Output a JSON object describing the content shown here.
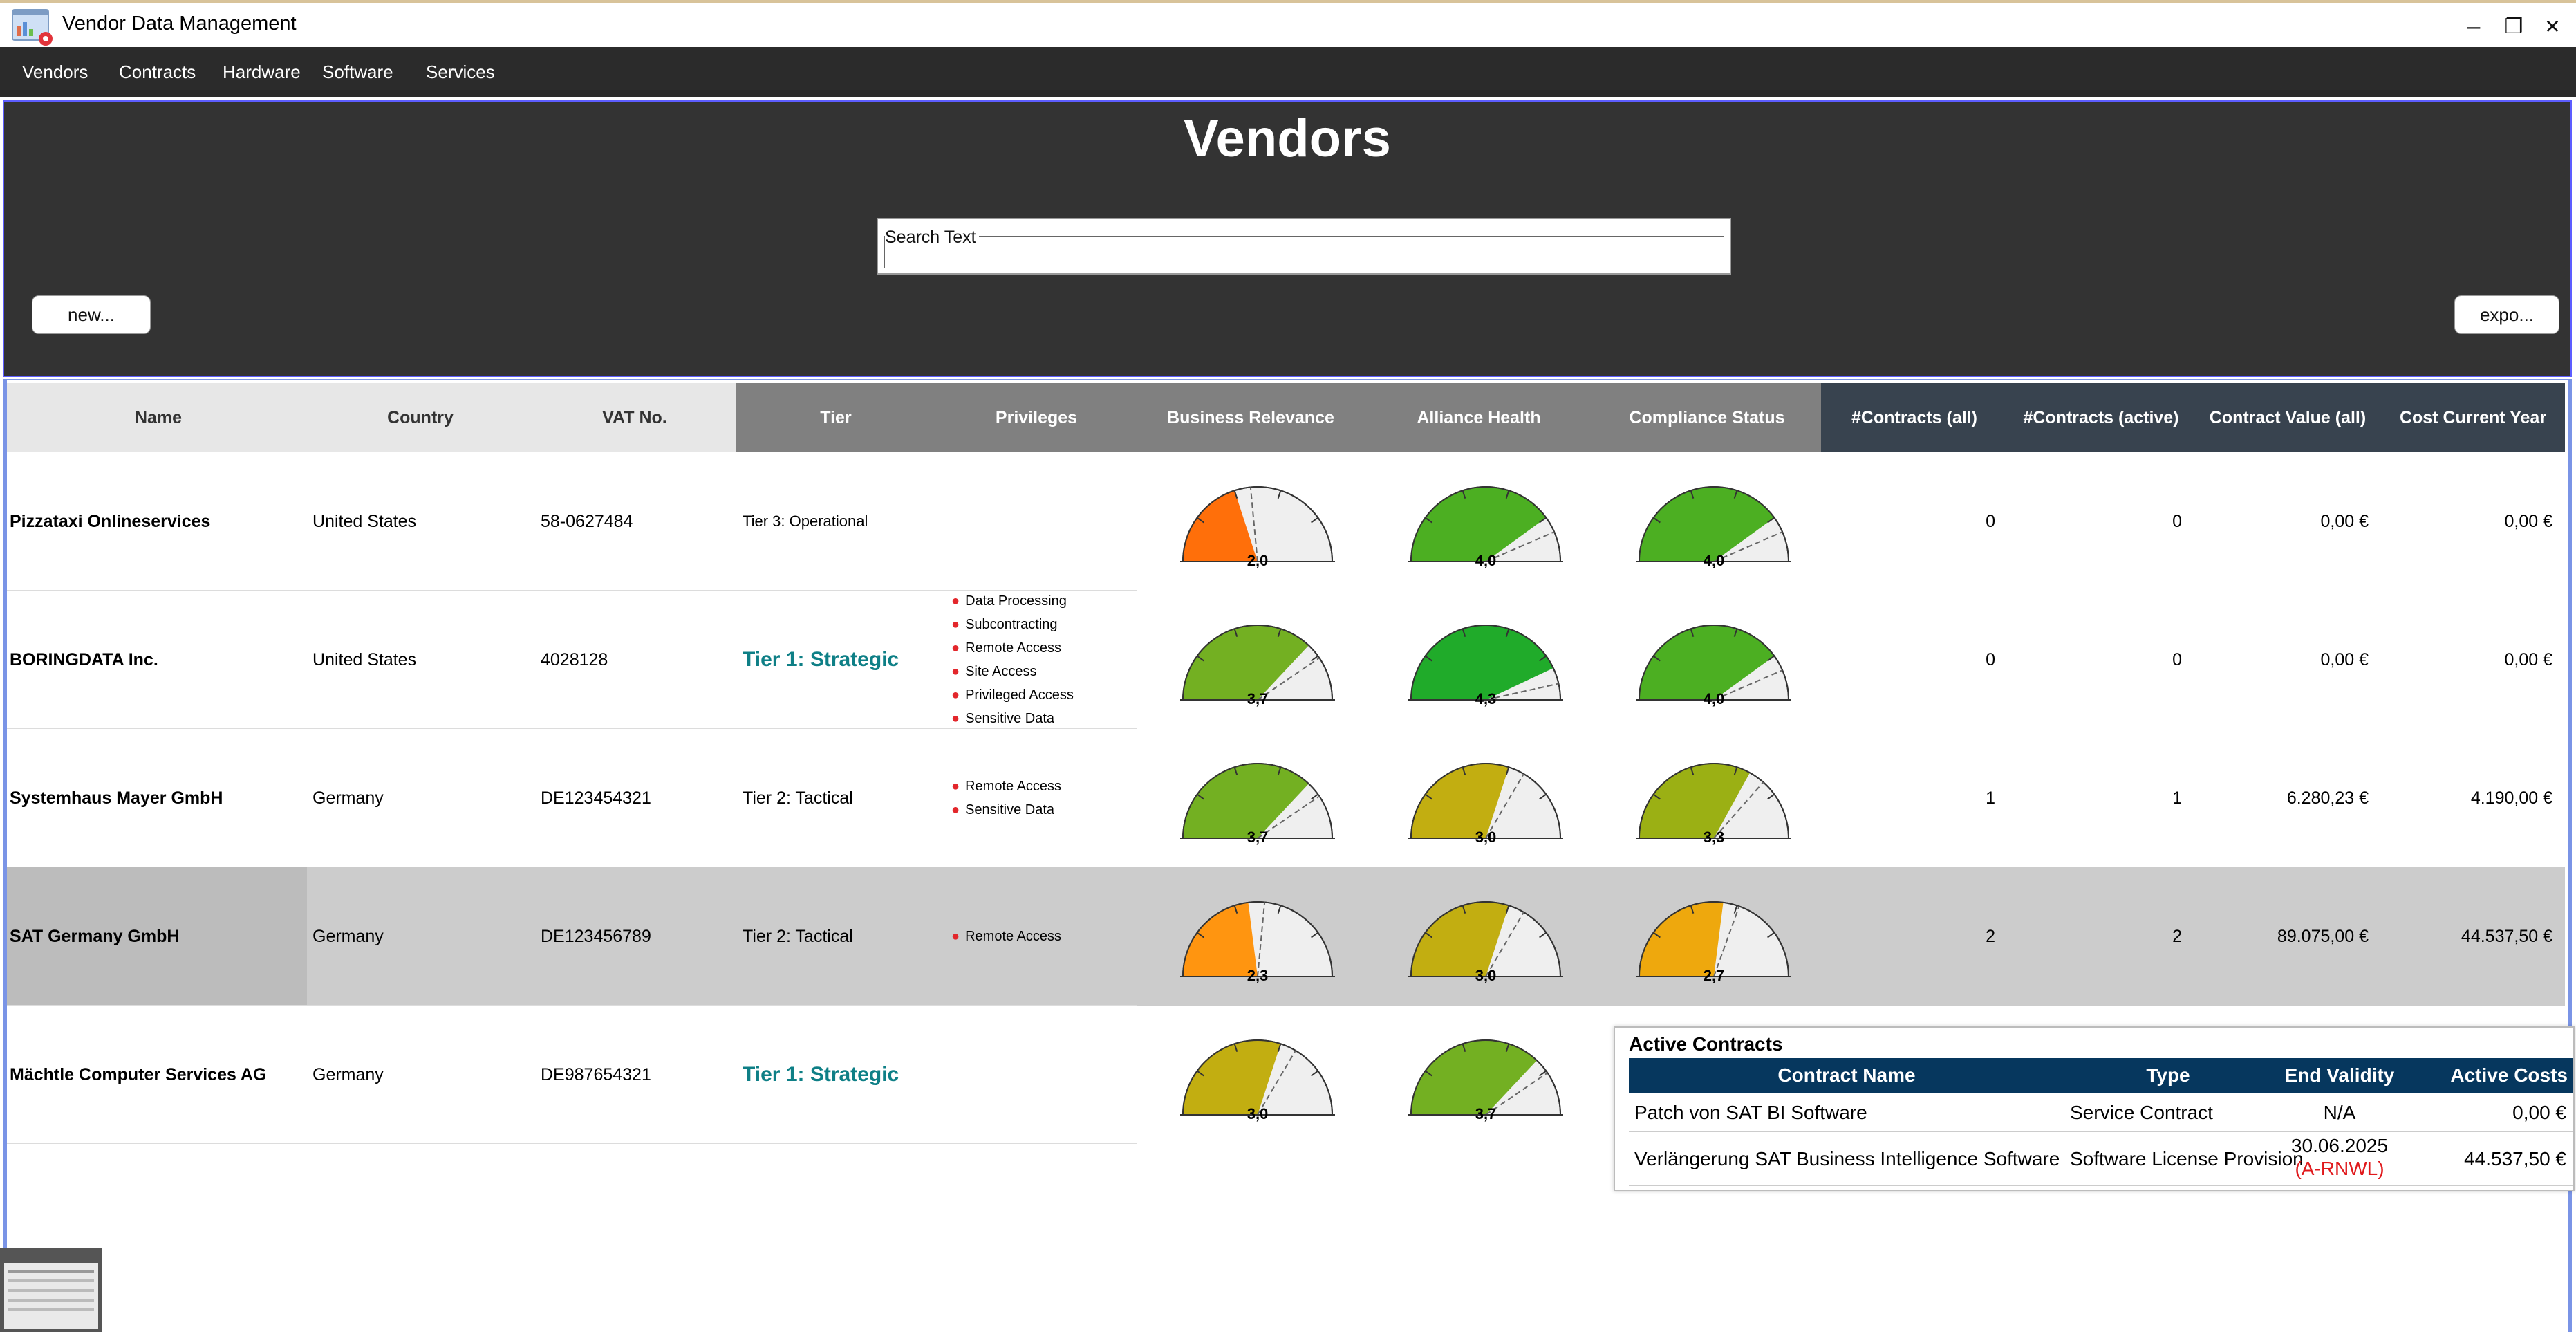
{
  "window": {
    "title": "Vendor Data Management",
    "minimize_glyph": "–",
    "restore_glyph": "❐",
    "close_glyph": "✕"
  },
  "menu": [
    "Vendors",
    "Contracts",
    "Hardware",
    "Software",
    "Services"
  ],
  "page": {
    "title": "Vendors",
    "search_label": "Search Text",
    "search_value": "",
    "new_button": "new...",
    "export_button": "expo..."
  },
  "colors": {
    "header_light": "#e7e7e7",
    "header_mid": "#808080",
    "header_dark": "#38434f",
    "tier_strategic": "#0e7f86",
    "privilege_dot": "#e3262b",
    "selected_row": "#cccccc",
    "popup_header": "#06375e",
    "renewal_red": "#e0191c"
  },
  "table": {
    "columns": [
      "Name",
      "Country",
      "VAT No.",
      "Tier",
      "Privileges",
      "Business Relevance",
      "Alliance Health",
      "Compliance Status",
      "#Contracts (all)",
      "#Contracts (active)",
      "Contract Value (all)",
      "Cost Current Year"
    ],
    "rows": [
      {
        "name": "Pizzataxi Onlineservices",
        "country": "United States",
        "vat": "58-0627484",
        "tier": "Tier 3: Operational",
        "tier_style": "small",
        "privileges": [],
        "business": {
          "value": 2.0,
          "label": "2,0",
          "color": "#ff6f0a"
        },
        "alliance": {
          "value": 4.0,
          "label": "4,0",
          "color": "#4caf22"
        },
        "compliance": {
          "value": 4.0,
          "label": "4,0",
          "color": "#4caf22"
        },
        "contracts_all": "0",
        "contracts_active": "0",
        "value_all": "0,00 €",
        "cost_year": "0,00 €"
      },
      {
        "name": "BORINGDATA Inc.",
        "country": "United States",
        "vat": "4028128",
        "tier": "Tier 1: Strategic",
        "tier_style": "strategic",
        "privileges": [
          "Data Processing",
          "Subcontracting",
          "Remote Access",
          "Site Access",
          "Privileged Access",
          "Sensitive Data"
        ],
        "business": {
          "value": 3.7,
          "label": "3,7",
          "color": "#73b022"
        },
        "alliance": {
          "value": 4.3,
          "label": "4,3",
          "color": "#20ab2a"
        },
        "compliance": {
          "value": 4.0,
          "label": "4,0",
          "color": "#4caf22"
        },
        "contracts_all": "0",
        "contracts_active": "0",
        "value_all": "0,00 €",
        "cost_year": "0,00 €"
      },
      {
        "name": "Systemhaus Mayer GmbH",
        "country": "Germany",
        "vat": "DE123454321",
        "tier": "Tier 2: Tactical",
        "tier_style": "normal",
        "privileges": [
          "Remote Access",
          "Sensitive Data"
        ],
        "business": {
          "value": 3.7,
          "label": "3,7",
          "color": "#73b022"
        },
        "alliance": {
          "value": 3.0,
          "label": "3,0",
          "color": "#c2ae11"
        },
        "compliance": {
          "value": 3.3,
          "label": "3,3",
          "color": "#9bb014"
        },
        "contracts_all": "1",
        "contracts_active": "1",
        "value_all": "6.280,23 €",
        "cost_year": "4.190,00 €"
      },
      {
        "name": "SAT Germany GmbH",
        "country": "Germany",
        "vat": "DE123456789",
        "tier": "Tier 2: Tactical",
        "tier_style": "normal",
        "privileges": [
          "Remote Access"
        ],
        "business": {
          "value": 2.3,
          "label": "2,3",
          "color": "#ff9510"
        },
        "alliance": {
          "value": 3.0,
          "label": "3,0",
          "color": "#c2ae11"
        },
        "compliance": {
          "value": 2.7,
          "label": "2,7",
          "color": "#eea80d"
        },
        "contracts_all": "2",
        "contracts_active": "2",
        "value_all": "89.075,00 €",
        "cost_year": "44.537,50 €",
        "selected": true
      },
      {
        "name": "Mächtle Computer Services AG",
        "country": "Germany",
        "vat": "DE987654321",
        "tier": "Tier 1: Strategic",
        "tier_style": "strategic",
        "privileges": [],
        "business": {
          "value": 3.0,
          "label": "3,0",
          "color": "#c2ae11"
        },
        "alliance": {
          "value": 3.7,
          "label": "3,7",
          "color": "#73b022"
        },
        "compliance": null,
        "contracts_all": "",
        "contracts_active": "",
        "value_all": "",
        "cost_year": ""
      }
    ]
  },
  "popup": {
    "title": "Active Contracts",
    "columns": [
      "Contract Name",
      "Type",
      "End Validity",
      "Active Costs"
    ],
    "rows": [
      {
        "name": "Patch von SAT BI Software",
        "type": "Service Contract",
        "end": "N/A",
        "end_note": "",
        "cost": "0,00 €"
      },
      {
        "name": "Verlängerung SAT Business Intelligence Software",
        "type": "Software License Provision",
        "end": "30.06.2025",
        "end_note": "(A-RNWL)",
        "cost": "44.537,50 €"
      }
    ]
  }
}
